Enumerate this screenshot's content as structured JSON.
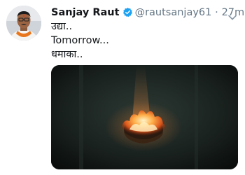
{
  "author": {
    "display_name": "Sanjay Raut",
    "handle": "@rautsanjay61",
    "separator": "·",
    "time": "27m"
  },
  "tweet": {
    "lines": [
      "उद्या..",
      "Tomorrow...",
      "धमाका.."
    ]
  },
  "icons": {
    "avatar": "profile-photo",
    "verified": "verified-badge-icon",
    "menu": "chevron-down-icon"
  },
  "colors": {
    "accent": "#1da1f2",
    "text": "#14171a",
    "muted": "#657786"
  }
}
